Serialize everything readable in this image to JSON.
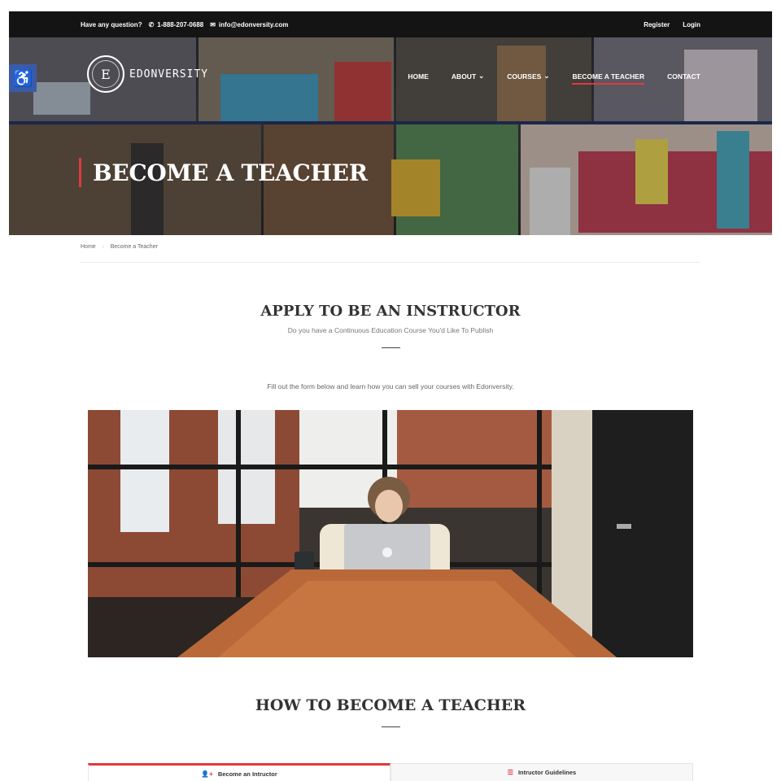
{
  "topbar": {
    "question": "Have any question?",
    "phone": "1-888-207-0688",
    "email": "info@edonversity.com",
    "register": "Register",
    "login": "Login"
  },
  "brand": {
    "logo_letter": "E",
    "name": "EDONVERSITY"
  },
  "nav": {
    "items": [
      {
        "label": "HOME",
        "dropdown": false,
        "active": false
      },
      {
        "label": "ABOUT",
        "dropdown": true,
        "active": false
      },
      {
        "label": "COURSES",
        "dropdown": true,
        "active": false
      },
      {
        "label": "BECOME A TEACHER",
        "dropdown": false,
        "active": true
      },
      {
        "label": "CONTACT",
        "dropdown": false,
        "active": false
      }
    ]
  },
  "hero": {
    "title": "BECOME A TEACHER"
  },
  "breadcrumb": {
    "home": "Home",
    "current": "Become a Teacher"
  },
  "apply": {
    "title": "APPLY TO BE AN INSTRUCTOR",
    "subtitle": "Do you have a Continuous Education Course You'd Like To Publish",
    "intro": "Fill out the form below and learn how you can sell your courses with Edonversity."
  },
  "how": {
    "title": "HOW TO BECOME A TEACHER"
  },
  "tabs": [
    {
      "label": "Become an Intructor",
      "icon": "user-plus-icon",
      "active": true
    },
    {
      "label": "Intructor Guidelines",
      "icon": "list-icon",
      "active": false
    }
  ],
  "colors": {
    "accent": "#e0393e",
    "topbar": "#141414",
    "accessibility": "#3a5ba8"
  }
}
